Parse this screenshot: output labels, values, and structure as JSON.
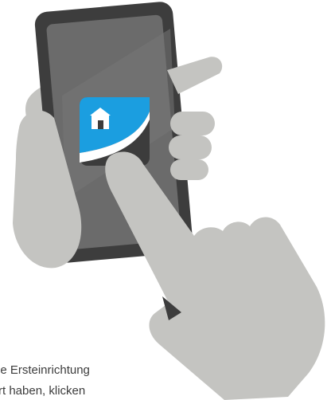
{
  "caption": {
    "line1": "ie Ersteinrichtung",
    "line2": "rt haben, klicken"
  },
  "app_icon": {
    "icon": "home-icon",
    "accent_color": "#1b9ee0"
  },
  "colors": {
    "phone_frame": "#3d3d3d",
    "phone_screen": "#6b6b6b",
    "hand": "#c4c4c1",
    "text": "#3c3c3c"
  }
}
